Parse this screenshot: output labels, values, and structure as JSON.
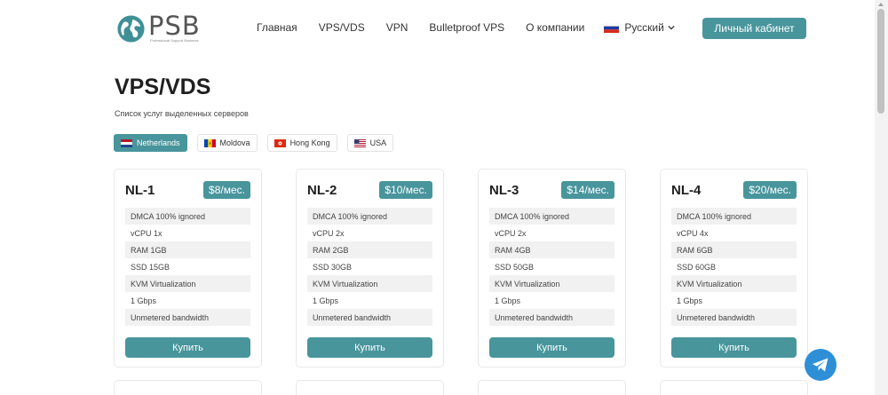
{
  "header": {
    "logo_text": "PSB",
    "logo_subtitle": "Professional Support Business",
    "nav": [
      "Главная",
      "VPS/VDS",
      "VPN",
      "Bulletproof VPS",
      "О компании"
    ],
    "language": "Русский",
    "cabinet_button": "Личный кабинет"
  },
  "page": {
    "title": "VPS/VDS",
    "subtitle": "Список услуг выделенных серверов"
  },
  "locations": [
    {
      "label": "Netherlands",
      "active": true
    },
    {
      "label": "Moldova",
      "active": false
    },
    {
      "label": "Hong Kong",
      "active": false
    },
    {
      "label": "USA",
      "active": false
    }
  ],
  "plans": [
    {
      "name": "NL-1",
      "price": "$8/мес.",
      "features": [
        "DMCA 100% ignored",
        "vCPU 1x",
        "RAM 1GB",
        "SSD 15GB",
        "KVM Virtualization",
        "1 Gbps",
        "Unmetered bandwidth"
      ],
      "buy": "Купить"
    },
    {
      "name": "NL-2",
      "price": "$10/мес.",
      "features": [
        "DMCA 100% ignored",
        "vCPU 2x",
        "RAM 2GB",
        "SSD 30GB",
        "KVM Virtualization",
        "1 Gbps",
        "Unmetered bandwidth"
      ],
      "buy": "Купить"
    },
    {
      "name": "NL-3",
      "price": "$14/мес.",
      "features": [
        "DMCA 100% ignored",
        "vCPU 2x",
        "RAM 4GB",
        "SSD 50GB",
        "KVM Virtualization",
        "1 Gbps",
        "Unmetered bandwidth"
      ],
      "buy": "Купить"
    },
    {
      "name": "NL-4",
      "price": "$20/мес.",
      "features": [
        "DMCA 100% ignored",
        "vCPU 4x",
        "RAM 6GB",
        "SSD 60GB",
        "KVM Virtualization",
        "1 Gbps",
        "Unmetered bandwidth"
      ],
      "buy": "Купить"
    }
  ],
  "colors": {
    "accent": "#48959c",
    "telegram": "#2e8fd6"
  },
  "icons": {
    "logo": "globe-icon",
    "language": "russia-flag-icon",
    "chat": "telegram-icon"
  }
}
